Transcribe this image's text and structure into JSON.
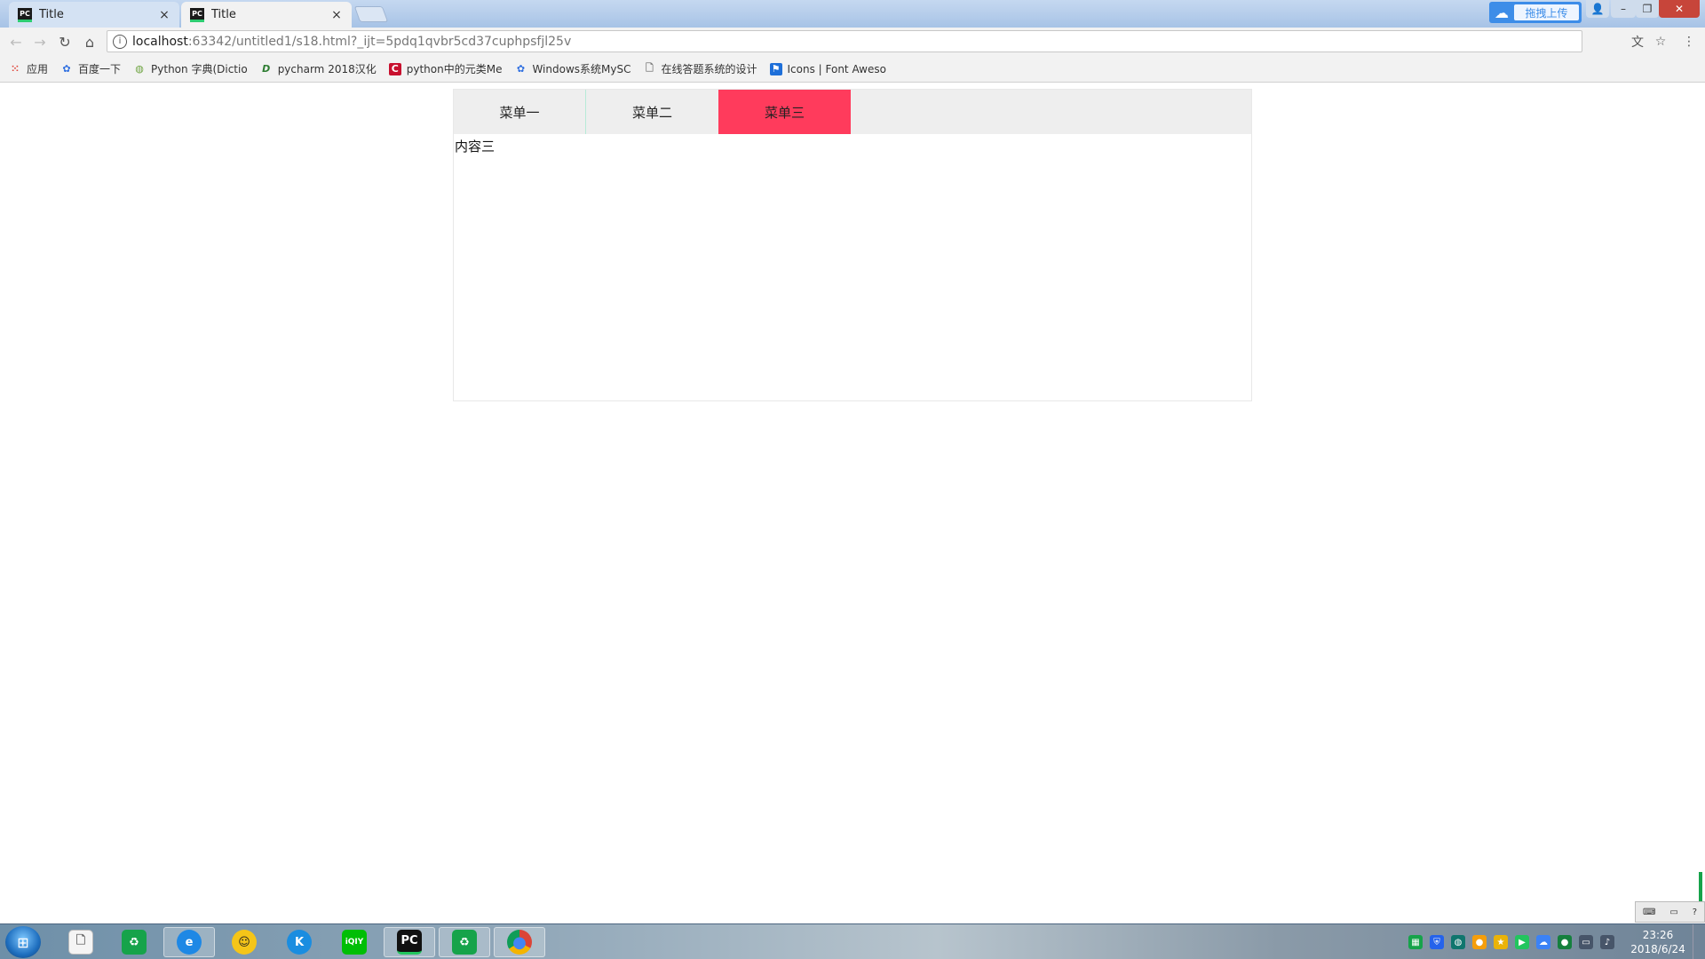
{
  "browser": {
    "tabs": [
      {
        "title": "Title",
        "favicon": "PC",
        "active": false
      },
      {
        "title": "Title",
        "favicon": "PC",
        "active": true
      }
    ],
    "close_glyph": "×",
    "upload_label": "拖拽上传",
    "address": {
      "host": "localhost",
      "path": ":63342/untitled1/s18.html?_ijt=5pdq1qvbr5cd37cuphpsfjl25v"
    }
  },
  "bookmarks": [
    {
      "label": "应用",
      "icon": "apps-grid-icon",
      "color": "#e0463b"
    },
    {
      "label": "百度一下",
      "icon": "baidu-paw-icon",
      "color": "#2f6fe0"
    },
    {
      "label": "Python 字典(Dictio",
      "icon": "runoob-icon",
      "color": "#6da33f"
    },
    {
      "label": "pycharm 2018汉化",
      "icon": "d-logo-icon",
      "color": "#2e7d32"
    },
    {
      "label": "python中的元类Me",
      "icon": "csdn-c-icon",
      "color": "#c8102e"
    },
    {
      "label": "Windows系统MySC",
      "icon": "baidu-paw-icon",
      "color": "#2f6fe0"
    },
    {
      "label": "在线答题系统的设计",
      "icon": "page-icon",
      "color": "#777777"
    },
    {
      "label": "Icons | Font Aweso",
      "icon": "flag-icon",
      "color": "#1e6fd9"
    }
  ],
  "page": {
    "menu": [
      "菜单一",
      "菜单二",
      "菜单三"
    ],
    "active_index": 2,
    "content": "内容三",
    "accent_color": "#ff3b5c"
  },
  "taskbar": {
    "apps": [
      {
        "name": "file-explorer",
        "glyph": "🗎"
      },
      {
        "name": "recycle-app",
        "glyph": "♻"
      },
      {
        "name": "ie-browser",
        "glyph": "e"
      },
      {
        "name": "qq-app",
        "glyph": "☺"
      },
      {
        "name": "kugou-app",
        "glyph": "K"
      },
      {
        "name": "iqiyi-app",
        "glyph": "iQIY"
      },
      {
        "name": "pycharm-app",
        "glyph": "PC"
      },
      {
        "name": "recycle-app-2",
        "glyph": "♻"
      },
      {
        "name": "chrome-app",
        "glyph": "◉"
      }
    ],
    "time": "23:26",
    "date": "2018/6/24"
  }
}
